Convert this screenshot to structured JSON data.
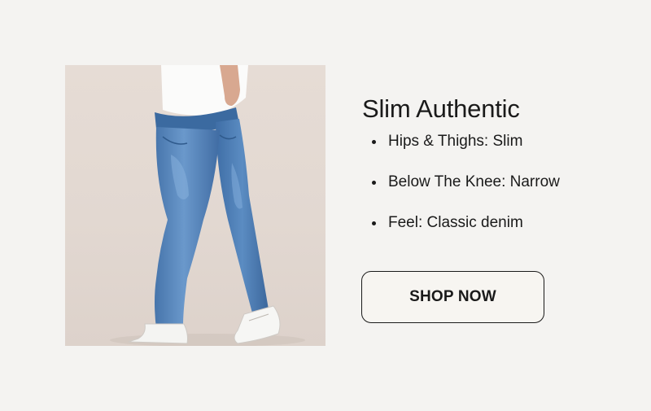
{
  "product": {
    "image_alt": "Model wearing blue slim jeans and white sneakers",
    "title": "Slim Authentic",
    "features": [
      "Hips & Thighs: Slim",
      "Below The Knee: Narrow",
      "Feel: Classic denim"
    ],
    "cta_label": "SHOP NOW"
  },
  "colors": {
    "background": "#f4f3f1",
    "text": "#1a1a1a",
    "denim": "#4f7fb5",
    "button_bg": "#f7f5f1"
  }
}
